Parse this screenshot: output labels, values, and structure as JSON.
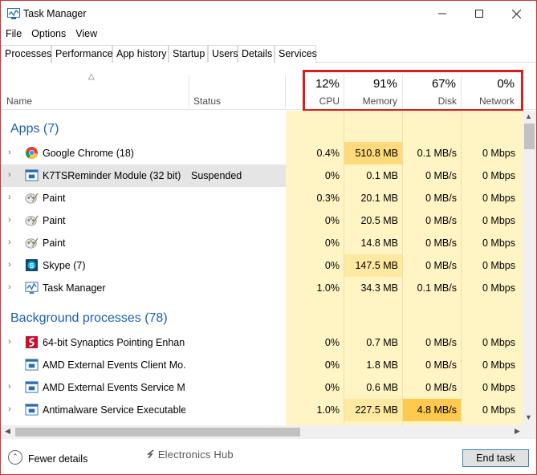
{
  "window": {
    "title": "Task Manager"
  },
  "menu": [
    "File",
    "Options",
    "View"
  ],
  "tabs": [
    "Processes",
    "Performance",
    "App history",
    "Startup",
    "Users",
    "Details",
    "Services"
  ],
  "header": {
    "name_label": "Name",
    "status_label": "Status",
    "cpu": {
      "pct": "12%",
      "label": "CPU"
    },
    "memory": {
      "pct": "91%",
      "label": "Memory"
    },
    "disk": {
      "pct": "67%",
      "label": "Disk"
    },
    "network": {
      "pct": "0%",
      "label": "Network"
    }
  },
  "groups": {
    "apps": "Apps (7)",
    "background": "Background processes (78)"
  },
  "rows": [
    {
      "name": "Google Chrome (18)",
      "status": "",
      "cpu": "0.4%",
      "memory": "510.8 MB",
      "disk": "0.1 MB/s",
      "network": "0 Mbps",
      "icon": "chrome-icon"
    },
    {
      "name": "K7TSReminder Module (32 bit)",
      "status": "Suspended",
      "cpu": "0%",
      "memory": "0.1 MB",
      "disk": "0 MB/s",
      "network": "0 Mbps",
      "icon": "window-app-icon"
    },
    {
      "name": "Paint",
      "status": "",
      "cpu": "0.3%",
      "memory": "20.1 MB",
      "disk": "0 MB/s",
      "network": "0 Mbps",
      "icon": "paint-icon"
    },
    {
      "name": "Paint",
      "status": "",
      "cpu": "0%",
      "memory": "20.5 MB",
      "disk": "0 MB/s",
      "network": "0 Mbps",
      "icon": "paint-icon"
    },
    {
      "name": "Paint",
      "status": "",
      "cpu": "0%",
      "memory": "14.8 MB",
      "disk": "0 MB/s",
      "network": "0 Mbps",
      "icon": "paint-icon"
    },
    {
      "name": "Skype (7)",
      "status": "",
      "cpu": "0%",
      "memory": "147.5 MB",
      "disk": "0 MB/s",
      "network": "0 Mbps",
      "icon": "skype-icon"
    },
    {
      "name": "Task Manager",
      "status": "",
      "cpu": "1.0%",
      "memory": "34.3 MB",
      "disk": "0.1 MB/s",
      "network": "0 Mbps",
      "icon": "task-manager-icon"
    },
    {
      "name": "64-bit Synaptics Pointing Enhan...",
      "status": "",
      "cpu": "0%",
      "memory": "0.7 MB",
      "disk": "0 MB/s",
      "network": "0 Mbps",
      "icon": "synaptics-icon"
    },
    {
      "name": "AMD External Events Client Mo...",
      "status": "",
      "cpu": "0%",
      "memory": "1.8 MB",
      "disk": "0 MB/s",
      "network": "0 Mbps",
      "icon": "window-app-icon"
    },
    {
      "name": "AMD External Events Service M...",
      "status": "",
      "cpu": "0%",
      "memory": "0.6 MB",
      "disk": "0 MB/s",
      "network": "0 Mbps",
      "icon": "window-app-icon"
    },
    {
      "name": "Antimalware Service Executable",
      "status": "",
      "cpu": "1.0%",
      "memory": "227.5 MB",
      "disk": "4.8 MB/s",
      "network": "0 Mbps",
      "icon": "window-app-icon"
    }
  ],
  "footer": {
    "fewer_details": "Fewer details",
    "end_task": "End task",
    "watermark": "Electronics Hub"
  },
  "colors": {
    "cell_bg": "#fff4c4",
    "memory_cell_bg": "#ffe8a0",
    "memory_cell_bg_strong": "#ffd97a",
    "disk_hot_bg": "#ffc94d",
    "group_text": "#1a5fb4",
    "highlight_box": "#d81e1e"
  }
}
